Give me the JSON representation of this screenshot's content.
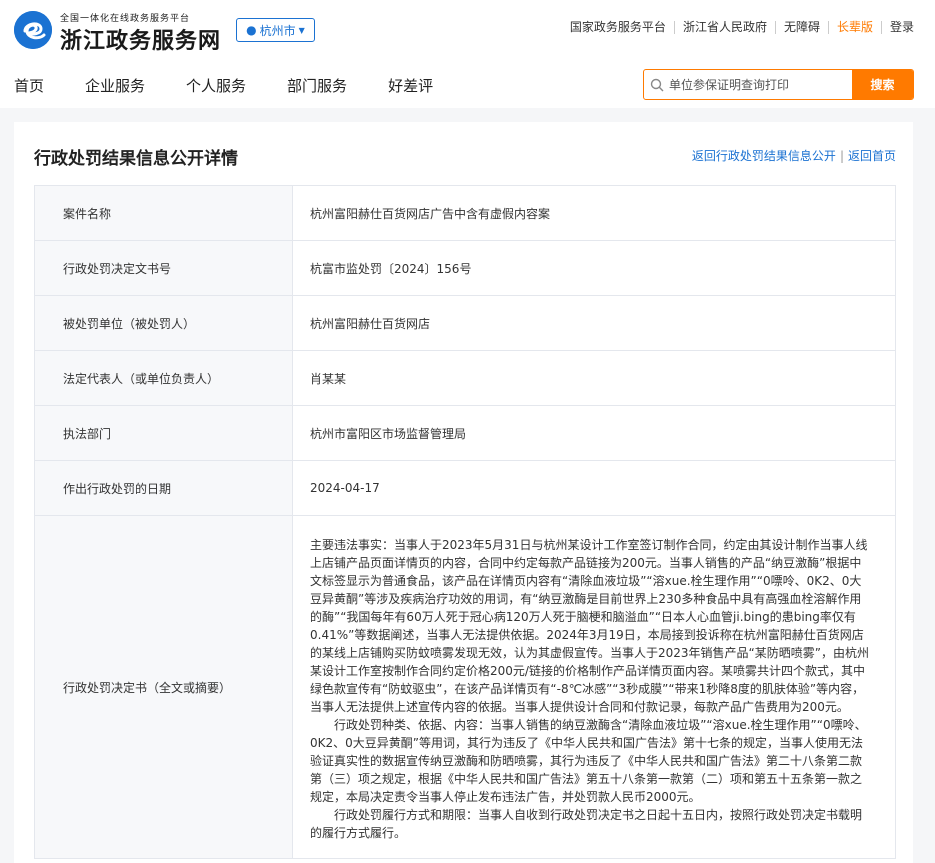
{
  "header": {
    "logo_subtitle": "全国一体化在线政务服务平台",
    "logo_title": "浙江政务服务网",
    "city": "杭州市",
    "top_links": [
      "国家政务服务平台",
      "浙江省人民政府",
      "无障碍",
      "长辈版",
      "登录"
    ]
  },
  "nav": [
    "首页",
    "企业服务",
    "个人服务",
    "部门服务",
    "好差评"
  ],
  "search": {
    "placeholder": "单位参保证明查询打印",
    "button": "搜索"
  },
  "page": {
    "title": "行政处罚结果信息公开详情",
    "back_list": "返回行政处罚结果信息公开",
    "back_home": "返回首页",
    "separator": "|"
  },
  "rows": [
    {
      "label": "案件名称",
      "value": "杭州富阳赫仕百货网店广告中含有虚假内容案"
    },
    {
      "label": "行政处罚决定文书号",
      "value": "杭富市监处罚〔2024〕156号"
    },
    {
      "label": "被处罚单位（被处罚人）",
      "value": "杭州富阳赫仕百货网店"
    },
    {
      "label": "法定代表人（或单位负责人）",
      "value": "肖某某"
    },
    {
      "label": "执法部门",
      "value": "杭州市富阳区市场监督管理局"
    },
    {
      "label": "作出行政处罚的日期",
      "value": "2024-04-17"
    }
  ],
  "decision": {
    "label": "行政处罚决定书（全文或摘要）",
    "p1": "主要违法事实：当事人于2023年5月31日与杭州某设计工作室签订制作合同，约定由其设计制作当事人线上店铺产品页面详情页的内容，合同中约定每款产品链接为200元。当事人销售的产品“纳豆激酶”根据中文标签显示为普通食品，该产品在详情页内容有“清除血液垃圾”“溶xue.栓生理作用”“0嘌呤、0K2、0大豆异黄酮”等涉及疾病治疗功效的用词，有“纳豆激酶是目前世界上230多种食品中具有高强血栓溶解作用的酶”“我国每年有60万人死于冠心病120万人死于脑梗和脑溢血”“日本人心血管ji.bing的患bing率仅有0.41%”等数据阐述，当事人无法提供依据。2024年3月19日，本局接到投诉称在杭州富阳赫仕百货网店的某线上店铺购买防蚊喷雾发现无效，认为其虚假宣传。当事人于2023年销售产品“某防晒喷雾”，由杭州某设计工作室按制作合同约定价格200元/链接的价格制作产品详情页面内容。某喷雾共计四个款式，其中绿色款宣传有“防蚊驱虫”，在该产品详情页有“-8℃冰感”“3秒成膜”“带来1秒降8度的肌肤体验”等内容，当事人无法提供上述宣传内容的依据。当事人提供设计合同和付款记录，每款产品广告费用为200元。",
    "p2": "行政处罚种类、依据、内容：当事人销售的纳豆激酶含“清除血液垃圾”“溶xue.栓生理作用”“0嘌呤、0K2、0大豆异黄酮”等用词，其行为违反了《中华人民共和国广告法》第十七条的规定，当事人使用无法验证真实性的数据宣传纳豆激酶和防晒喷雾，其行为违反了《中华人民共和国广告法》第二十八条第二款第（三）项之规定，根据《中华人民共和国广告法》第五十八条第一款第（二）项和第五十五条第一款之规定，本局决定责令当事人停止发布违法广告，并处罚款人民币2000元。",
    "p3": "行政处罚履行方式和期限：当事人自收到行政处罚决定书之日起十五日内，按照行政处罚决定书载明的履行方式履行。"
  },
  "colors": {
    "brand_blue": "#1b72d2",
    "accent_orange": "#ff7a00"
  }
}
